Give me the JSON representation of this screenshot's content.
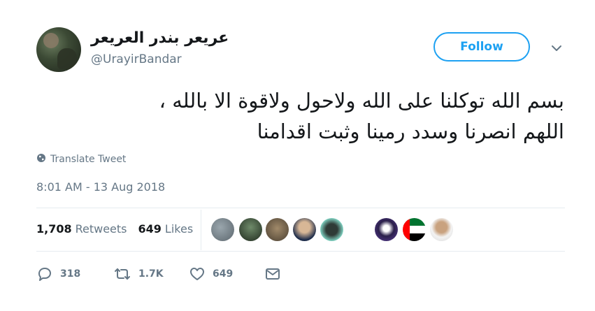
{
  "user": {
    "display_name": "عريعر بندر العريعر",
    "handle": "@UrayirBandar"
  },
  "follow_label": "Follow",
  "tweet": {
    "line1": "بسم الله توكلنا على الله ولاحول ولاقوة الا بالله ،",
    "line2": "اللهم انصرنا وسدد رمينا وثبت اقدامنا"
  },
  "translate_label": "Translate Tweet",
  "timestamp": "8:01 AM - 13 Aug 2018",
  "stats": {
    "retweets_count": "1,708",
    "retweets_label": "Retweets",
    "likes_count": "649",
    "likes_label": "Likes"
  },
  "actions": {
    "reply_count": "318",
    "retweet_count": "1.7K",
    "like_count": "649"
  },
  "colors": {
    "accent": "#1da1f2",
    "secondary_text": "#657786",
    "divider": "#e6ecf0"
  },
  "icons": [
    "globe-icon",
    "chevron-down-icon",
    "reply-icon",
    "retweet-icon",
    "heart-icon",
    "message-icon",
    "uae-flag-icon"
  ]
}
